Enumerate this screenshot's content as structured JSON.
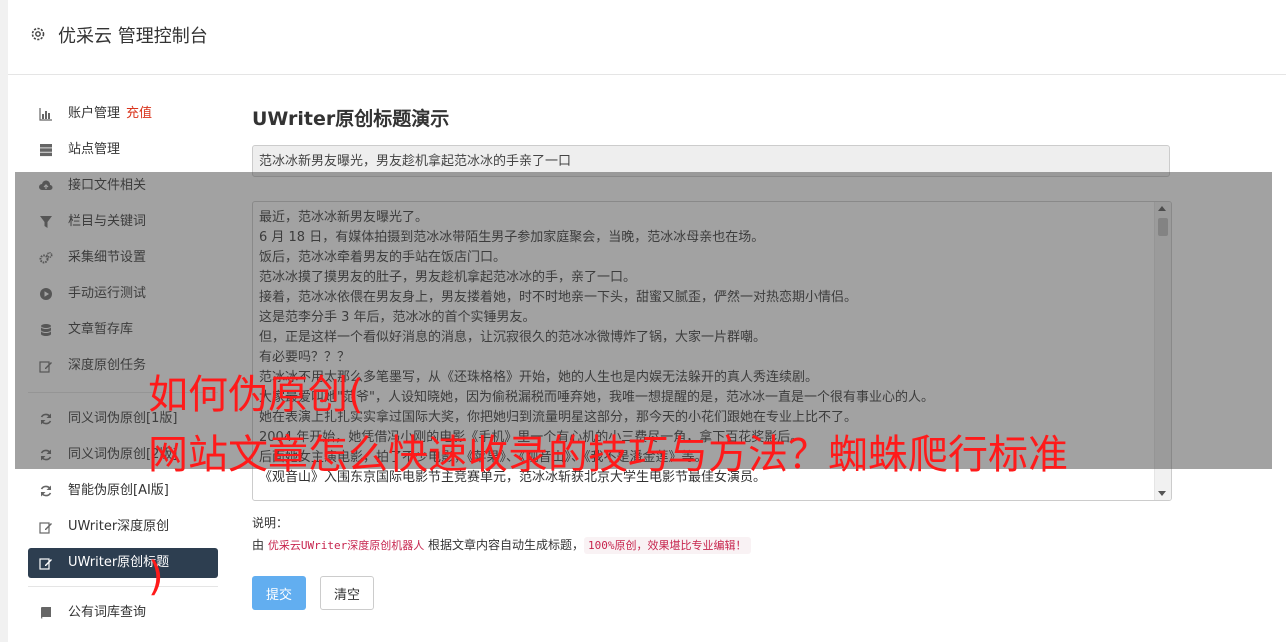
{
  "header": {
    "title": "优采云 管理控制台",
    "icon": "gear-icon"
  },
  "sidebar": {
    "items": [
      {
        "label": "账户管理",
        "extra": "充值",
        "icon": "bar-chart-icon"
      },
      {
        "label": "站点管理",
        "icon": "server-icon"
      },
      {
        "label": "接口文件相关",
        "icon": "cloud-upload-icon"
      },
      {
        "label": "栏目与关键词",
        "icon": "filter-icon"
      },
      {
        "label": "采集细节设置",
        "icon": "gears-icon"
      },
      {
        "label": "手动运行测试",
        "icon": "play-circle-icon"
      },
      {
        "label": "文章暂存库",
        "icon": "database-icon"
      },
      {
        "label": "深度原创任务",
        "icon": "edit-icon"
      }
    ],
    "items2": [
      {
        "label": "同义词伪原创[1版]",
        "icon": "refresh-icon"
      },
      {
        "label": "同义词伪原创[2版]",
        "icon": "refresh-icon"
      },
      {
        "label": "智能伪原创[AI版]",
        "icon": "refresh-icon"
      },
      {
        "label": "UWriter深度原创",
        "icon": "edit-icon"
      },
      {
        "label": "UWriter原创标题",
        "icon": "edit-icon",
        "active": true
      }
    ],
    "items3": [
      {
        "label": "公有词库查询",
        "icon": "book-icon"
      }
    ]
  },
  "main": {
    "title": "UWriter原创标题演示",
    "title_input_value": "范冰冰新男友曝光，男友趁机拿起范冰冰的手亲了一口",
    "content_lines": [
      "最近，范冰冰新男友曝光了。",
      "6 月 18 日，有媒体拍摄到范冰冰带陌生男子参加家庭聚会，当晚，范冰冰母亲也在场。",
      "饭后，范冰冰牵着男友的手站在饭店门口。",
      "范冰冰摸了摸男友的肚子，男友趁机拿起范冰冰的手，亲了一口。",
      "接着，范冰冰依偎在男友身上，男友搂着她，时不时地亲一下头，甜蜜又腻歪，俨然一对热恋期小情侣。",
      "这是范李分手 3 年后，范冰冰的首个实锤男友。",
      "但，正是这样一个看似好消息的消息，让沉寂很久的范冰冰微博炸了锅，大家一片群嘲。",
      "有必要吗？？？",
      "范冰冰不用太那么多笔墨写，从《还珠格格》开始，她的人生也是内娱无法躲开的真人秀连续剧。",
      "大家最爱叫她\"范爷\"，人设知晓她，因为偷税漏税而唾弃她，我唯一想提醒的是，范冰冰一直是一个很有事业心的人。",
      "她在表演上扎扎实实拿过国际大奖，你把她归到流量明星这部分，那今天的小花们跟她在专业上比不了。",
      "2004 年开始，她凭借冯小刚的电影《手机》里一个有心机的小三费尽一角，拿下百花奖影后。",
      "后面她女主演电影，拍了不少电影，《苹果》、《观音山》、《我不是潘金莲》等。",
      "《观音山》入围东京国际电影节主竞赛单元，范冰冰斩获北京大学生电影节最佳女演员。"
    ],
    "note_label": "说明：",
    "note_prefix": "由",
    "note_link": "优采云UWriter深度原创机器人",
    "note_middle": "根据文章内容自动生成标题，",
    "note_badge": "100%原创，效果堪比专业编辑！",
    "submit_label": "提交",
    "clear_label": "清空"
  },
  "watermark": {
    "line1": "如何伪原创(",
    "line2": "网站文章怎么快速收录的技巧与方法？蜘蛛爬行标准",
    "line3": ")"
  },
  "colors": {
    "accent": "#2d3e50",
    "primary_button": "#62aef0",
    "watermark": "#ff1a1a",
    "highlight": "#c7254e"
  }
}
